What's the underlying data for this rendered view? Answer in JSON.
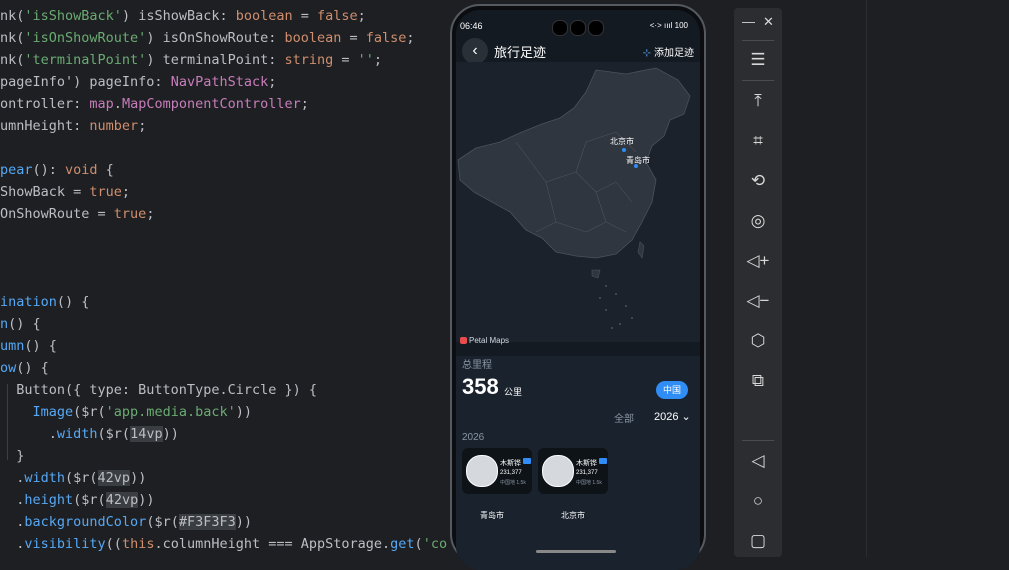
{
  "code_lines": [
    [
      [
        "pl",
        "nk("
      ],
      [
        "str",
        "'isShowBack'"
      ],
      [
        "pl",
        ") isShowBack: "
      ],
      [
        "kw",
        "boolean"
      ],
      [
        "pl",
        " = "
      ],
      [
        "kw",
        "false"
      ],
      [
        "pl",
        ";"
      ]
    ],
    [
      [
        "pl",
        "nk("
      ],
      [
        "str",
        "'isOnShowRoute'"
      ],
      [
        "pl",
        ") isOnShowRoute: "
      ],
      [
        "kw",
        "boolean"
      ],
      [
        "pl",
        " = "
      ],
      [
        "kw",
        "false"
      ],
      [
        "pl",
        ";"
      ]
    ],
    [
      [
        "pl",
        "nk("
      ],
      [
        "str",
        "'terminalPoint'"
      ],
      [
        "pl",
        ") terminalPoint: "
      ],
      [
        "kw",
        "string"
      ],
      [
        "pl",
        " = "
      ],
      [
        "str",
        "''"
      ],
      [
        "pl",
        ";"
      ]
    ],
    [
      [
        "pl",
        "pageInfo') pageInfo: "
      ],
      [
        "ty",
        "NavPathStack"
      ],
      [
        "pl",
        ";"
      ]
    ],
    [
      [
        "pl",
        "ontroller: "
      ],
      [
        "ty",
        "map"
      ],
      [
        "pl",
        "."
      ],
      [
        "ty",
        "MapComponentController"
      ],
      [
        "pl",
        ";"
      ]
    ],
    [
      [
        "pl",
        "umnHeight: "
      ],
      [
        "kw",
        "number"
      ],
      [
        "pl",
        ";"
      ]
    ],
    [
      [
        "pl",
        ""
      ]
    ],
    [
      [
        "fn",
        "pear"
      ],
      [
        "pl",
        "(): "
      ],
      [
        "kw",
        "void"
      ],
      [
        "pl",
        " {"
      ]
    ],
    [
      [
        "pl",
        "ShowBack = "
      ],
      [
        "kw",
        "true"
      ],
      [
        "pl",
        ";"
      ]
    ],
    [
      [
        "pl",
        "OnShowRoute = "
      ],
      [
        "kw",
        "true"
      ],
      [
        "pl",
        ";"
      ]
    ],
    [
      [
        "pl",
        ""
      ]
    ],
    [
      [
        "pl",
        ""
      ]
    ],
    [
      [
        "pl",
        ""
      ]
    ],
    [
      [
        "fn",
        "ination"
      ],
      [
        "pl",
        "() {"
      ]
    ],
    [
      [
        "fn",
        "n"
      ],
      [
        "pl",
        "() {"
      ]
    ],
    [
      [
        "fn",
        "umn"
      ],
      [
        "pl",
        "() {"
      ]
    ],
    [
      [
        "fn",
        "ow"
      ],
      [
        "pl",
        "() {"
      ]
    ],
    [
      [
        "pl",
        "  Button({ type: ButtonType.Circle }) {"
      ]
    ],
    [
      [
        "pl",
        "    "
      ],
      [
        "fn",
        "Image"
      ],
      [
        "pl",
        "($r("
      ],
      [
        "str",
        "'app.media.back'"
      ],
      [
        "pl",
        "))"
      ]
    ],
    [
      [
        "pl",
        "      ."
      ],
      [
        "fn",
        "width"
      ],
      [
        "pl",
        "($r("
      ],
      [
        "hl",
        "14vp"
      ],
      [
        "pl",
        "))"
      ]
    ],
    [
      [
        "pl",
        "  }"
      ]
    ],
    [
      [
        "pl",
        "  ."
      ],
      [
        "fn",
        "width"
      ],
      [
        "pl",
        "($r("
      ],
      [
        "hl",
        "42vp"
      ],
      [
        "pl",
        "))"
      ]
    ],
    [
      [
        "pl",
        "  ."
      ],
      [
        "fn",
        "height"
      ],
      [
        "pl",
        "($r("
      ],
      [
        "hl",
        "42vp"
      ],
      [
        "pl",
        "))"
      ]
    ],
    [
      [
        "pl",
        "  ."
      ],
      [
        "fn",
        "backgroundColor"
      ],
      [
        "pl",
        "($r("
      ],
      [
        "hl",
        "#F3F3F3"
      ],
      [
        "pl",
        "))"
      ]
    ],
    [
      [
        "pl",
        "  ."
      ],
      [
        "fn",
        "visibility"
      ],
      [
        "pl",
        "(("
      ],
      [
        "th",
        "this"
      ],
      [
        "pl",
        ".columnHeight === AppStorage."
      ],
      [
        "fn",
        "get"
      ],
      [
        "pl",
        "("
      ],
      [
        "str",
        "'colum"
      ]
    ]
  ],
  "colors": {
    "keyword": "#cf8e6d",
    "string": "#6aab73",
    "type": "#c77dbb",
    "function": "#56a8f5",
    "accent": "#2f8df5"
  },
  "phone": {
    "status": {
      "time": "06:46",
      "right": "<·> ıııl 100"
    },
    "nav": {
      "back_icon": "‹",
      "title": "旅行足迹",
      "add_label": "添加足迹"
    },
    "map": {
      "city_labels": [
        "北京市",
        "青岛市"
      ],
      "attribution": "Petal Maps"
    },
    "summary": {
      "total_label": "总里程",
      "distance": "358",
      "unit": "公里",
      "country_btn": "中国"
    },
    "filter": {
      "all_label": "全部",
      "year": "2026 ⌄"
    },
    "year_header": "2026",
    "cards": [
      {
        "name": "木斯铧",
        "count": "231,377",
        "sub": "中国地 1.5k",
        "city": "青岛市"
      },
      {
        "name": "木斯铧",
        "count": "231,377",
        "sub": "中国地 1.5k",
        "city": "北京市"
      }
    ]
  },
  "toolbar": {
    "close_icon": "✕",
    "minimize_icon": "—",
    "items": [
      "menu-icon",
      "pin-top-icon",
      "crop-icon",
      "rotate-icon",
      "screenshot-icon",
      "volume-up-icon",
      "volume-down-icon",
      "rotate-device-icon",
      "multi-screen-icon",
      "back-icon",
      "home-icon",
      "recents-icon"
    ]
  }
}
